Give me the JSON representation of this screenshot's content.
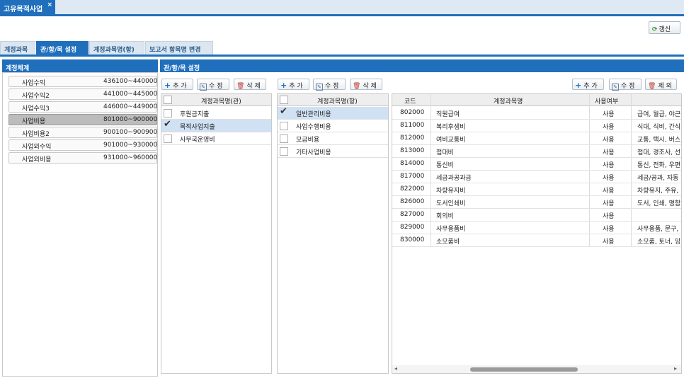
{
  "window": {
    "tab_title": "고유목적사업",
    "close_glyph": "×"
  },
  "toolbar": {
    "refresh_label": "갱신",
    "refresh_icon": "refresh-icon"
  },
  "tabs": [
    {
      "label": "계정과목"
    },
    {
      "label": "관/항/목 설정"
    },
    {
      "label": "계정과목명(항)"
    },
    {
      "label": "보고서 항목명 변경"
    }
  ],
  "left": {
    "header": "계정체계",
    "items": [
      {
        "name": "사업수익",
        "range": "436100~440000"
      },
      {
        "name": "사업수익2",
        "range": "441000~445000"
      },
      {
        "name": "사업수익3",
        "range": "446000~449000"
      },
      {
        "name": "사업비용",
        "range": "801000~900000"
      },
      {
        "name": "사업비용2",
        "range": "900100~900900"
      },
      {
        "name": "사업외수익",
        "range": "901000~930000"
      },
      {
        "name": "사업외비용",
        "range": "931000~960000"
      }
    ]
  },
  "main": {
    "header": "관/항/목 설정"
  },
  "buttons": {
    "add": "추 가",
    "edit": "수 정",
    "delete": "삭 제",
    "exclude": "제 외"
  },
  "gwan": {
    "column": "계정과목명(관)",
    "rows": [
      {
        "label": "후원금지출",
        "checked": false
      },
      {
        "label": "목적사업지출",
        "checked": true
      },
      {
        "label": "사무국운영비",
        "checked": false
      }
    ]
  },
  "hang": {
    "column": "계정과목명(항)",
    "rows": [
      {
        "label": "일반관리비용",
        "checked": true
      },
      {
        "label": "사업수행비용",
        "checked": false
      },
      {
        "label": "모금비용",
        "checked": false
      },
      {
        "label": "기타사업비용",
        "checked": false
      }
    ]
  },
  "mok": {
    "columns": {
      "code": "코드",
      "name": "계정과목명",
      "use": "사용여부",
      "desc": ""
    },
    "rows": [
      {
        "code": "802000",
        "name": "직원급여",
        "use": "사용",
        "desc": "급여, 월급, 야근"
      },
      {
        "code": "811000",
        "name": "복리후생비",
        "use": "사용",
        "desc": "식대, 식비, 간식"
      },
      {
        "code": "812000",
        "name": "여비교통비",
        "use": "사용",
        "desc": "교통, 택시, 버스"
      },
      {
        "code": "813000",
        "name": "접대비",
        "use": "사용",
        "desc": "접대, 경조사, 선"
      },
      {
        "code": "814000",
        "name": "통신비",
        "use": "사용",
        "desc": "통신, 전화, 우편"
      },
      {
        "code": "817000",
        "name": "세금과공과금",
        "use": "사용",
        "desc": "세금/공과, 자동"
      },
      {
        "code": "822000",
        "name": "차량유지비",
        "use": "사용",
        "desc": "차량유지, 주유,"
      },
      {
        "code": "826000",
        "name": "도서인쇄비",
        "use": "사용",
        "desc": "도서, 인쇄, 명함"
      },
      {
        "code": "827000",
        "name": "회의비",
        "use": "사용",
        "desc": ""
      },
      {
        "code": "829000",
        "name": "사무용품비",
        "use": "사용",
        "desc": "사무용품, 문구,"
      },
      {
        "code": "830000",
        "name": "소모품비",
        "use": "사용",
        "desc": "소모품, 토너, 잉"
      }
    ]
  },
  "scroll": {
    "left_arrow": "◂",
    "right_arrow": "▸"
  }
}
